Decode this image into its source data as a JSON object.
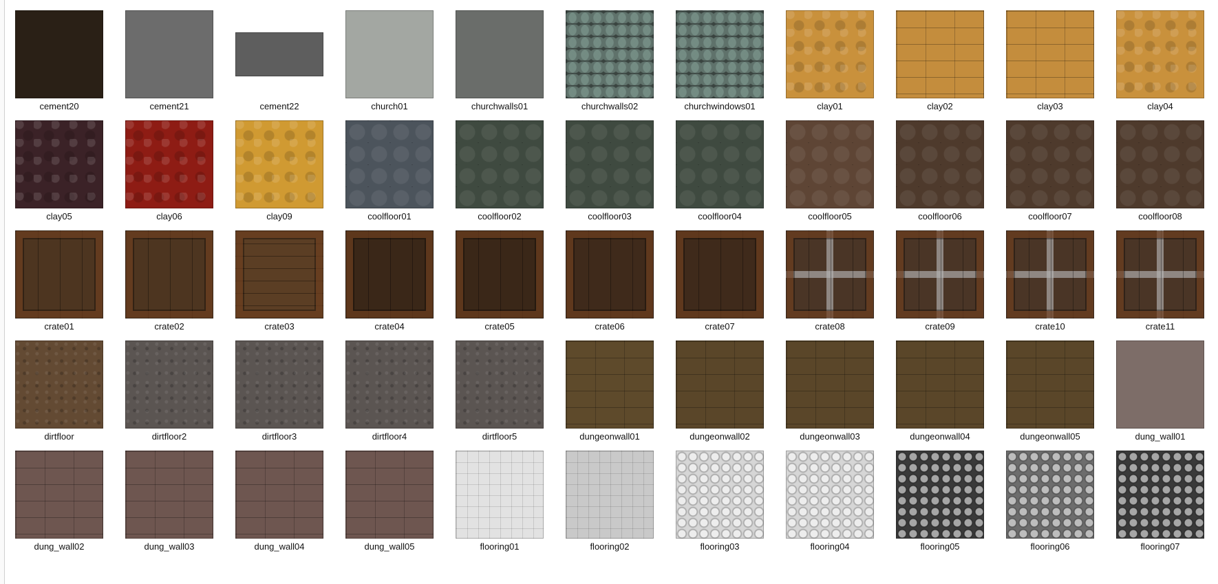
{
  "items": [
    {
      "name": "cement20",
      "swatch": "cement-dark"
    },
    {
      "name": "cement21",
      "swatch": "cement-gray"
    },
    {
      "name": "cement22",
      "swatch": "cement-gray-wide"
    },
    {
      "name": "church01",
      "swatch": "stone-blocks"
    },
    {
      "name": "churchwalls01",
      "swatch": "stone-blocks-dark"
    },
    {
      "name": "churchwalls02",
      "swatch": "church-window"
    },
    {
      "name": "churchwindows01",
      "swatch": "church-window"
    },
    {
      "name": "clay01",
      "swatch": "clay-orange"
    },
    {
      "name": "clay02",
      "swatch": "clay-orange-bricks"
    },
    {
      "name": "clay03",
      "swatch": "clay-orange-bricks"
    },
    {
      "name": "clay04",
      "swatch": "clay-orange"
    },
    {
      "name": "clay05",
      "swatch": "clay-purple"
    },
    {
      "name": "clay06",
      "swatch": "clay-red"
    },
    {
      "name": "clay09",
      "swatch": "clay-yellow"
    },
    {
      "name": "coolfloor01",
      "swatch": "octagon-gray"
    },
    {
      "name": "coolfloor02",
      "swatch": "octagon-green"
    },
    {
      "name": "coolfloor03",
      "swatch": "octagon-green"
    },
    {
      "name": "coolfloor04",
      "swatch": "octagon-green"
    },
    {
      "name": "coolfloor05",
      "swatch": "octagon-brown"
    },
    {
      "name": "coolfloor06",
      "swatch": "octagon-brown-trim"
    },
    {
      "name": "coolfloor07",
      "swatch": "octagon-brown-trim"
    },
    {
      "name": "coolfloor08",
      "swatch": "octagon-brown-trim"
    },
    {
      "name": "crate01",
      "swatch": "crate-vertical"
    },
    {
      "name": "crate02",
      "swatch": "crate-vertical"
    },
    {
      "name": "crate03",
      "swatch": "crate-horizontal"
    },
    {
      "name": "crate04",
      "swatch": "crate-dark"
    },
    {
      "name": "crate05",
      "swatch": "crate-dark"
    },
    {
      "name": "crate06",
      "swatch": "crate-fragile"
    },
    {
      "name": "crate07",
      "swatch": "crate-fragile"
    },
    {
      "name": "crate08",
      "swatch": "crate-bars"
    },
    {
      "name": "crate09",
      "swatch": "crate-bars"
    },
    {
      "name": "crate10",
      "swatch": "crate-bars"
    },
    {
      "name": "crate11",
      "swatch": "crate-bars"
    },
    {
      "name": "dirtfloor",
      "swatch": "dirt"
    },
    {
      "name": "dirtfloor2",
      "swatch": "dirt-metal"
    },
    {
      "name": "dirtfloor3",
      "swatch": "dirt-metal"
    },
    {
      "name": "dirtfloor4",
      "swatch": "dirt-metal"
    },
    {
      "name": "dirtfloor5",
      "swatch": "dirt-metal"
    },
    {
      "name": "dungeonwall01",
      "swatch": "dungeon-bricks"
    },
    {
      "name": "dungeonwall02",
      "swatch": "dungeon-bricks-pipes"
    },
    {
      "name": "dungeonwall03",
      "swatch": "dungeon-bricks-pipes"
    },
    {
      "name": "dungeonwall04",
      "swatch": "dungeon-bricks-pipes"
    },
    {
      "name": "dungeonwall05",
      "swatch": "dungeon-bricks-pipes"
    },
    {
      "name": "dung_wall01",
      "swatch": "dung-wall"
    },
    {
      "name": "dung_wall02",
      "swatch": "dung-wall-bricks"
    },
    {
      "name": "dung_wall03",
      "swatch": "dung-wall-bricks"
    },
    {
      "name": "dung_wall04",
      "swatch": "dung-wall-bricks"
    },
    {
      "name": "dung_wall05",
      "swatch": "dung-wall-bricks"
    },
    {
      "name": "flooring01",
      "swatch": "tile-white"
    },
    {
      "name": "flooring02",
      "swatch": "tile-lightgray"
    },
    {
      "name": "flooring03",
      "swatch": "circles-light"
    },
    {
      "name": "flooring04",
      "swatch": "circles-light"
    },
    {
      "name": "flooring05",
      "swatch": "circles-dark"
    },
    {
      "name": "flooring06",
      "swatch": "circles-gray"
    },
    {
      "name": "flooring07",
      "swatch": "circles-dark"
    }
  ],
  "swatches": {
    "cement-dark": "#2a2016",
    "cement-gray": "#6c6c6c",
    "cement-gray-wide": "#5e5e5e",
    "stone-blocks": "#a3a7a2",
    "stone-blocks-dark": "#6a6d6a",
    "church-window": "#3a4440",
    "clay-orange": "#c9913c",
    "clay-orange-bricks": "#c48d3d",
    "clay-purple": "#3b2227",
    "clay-red": "#8e1c14",
    "clay-yellow": "#d09a32",
    "octagon-gray": "#4c545c",
    "octagon-green": "#3f4a40",
    "octagon-brown": "#5e4535",
    "octagon-brown-trim": "#4e3a2c",
    "crate-vertical": "#4d3520",
    "crate-horizontal": "#5b3e24",
    "crate-dark": "#3a2718",
    "crate-fragile": "#3f2a1b",
    "crate-bars": "#4a3526",
    "dirt": "#634a33",
    "dirt-metal": "#5b5552",
    "dungeon-bricks": "#5e4a2b",
    "dungeon-bricks-pipes": "#5a4629",
    "dung-wall": "#7d6d68",
    "dung-wall-bricks": "#6e5650",
    "tile-white": "#e2e2e2",
    "tile-lightgray": "#c9c9c9",
    "circles-light": "#d6d6d6",
    "circles-dark": "#3a3a3a",
    "circles-gray": "#6d6d6d"
  }
}
